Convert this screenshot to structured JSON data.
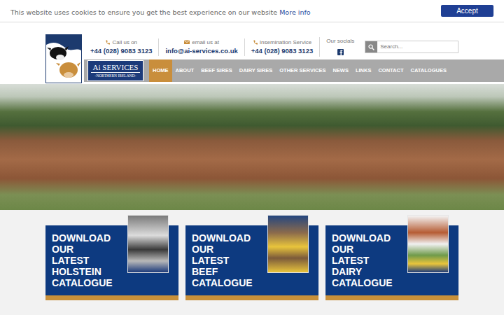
{
  "cookie_bar": {
    "text": "This website uses cookies to ensure you get the best experience on our website",
    "link": "More info",
    "button": "Accept"
  },
  "logo": {
    "title": "Ai SERVICES",
    "subtitle": "-NORTHERN IRELAND-"
  },
  "contacts": [
    {
      "label": "Call us on",
      "value": "+44 (028) 9083 3123",
      "kind": "phone"
    },
    {
      "label": "email us at",
      "value": "info@ai-services.co.uk",
      "kind": "email"
    },
    {
      "label": "Insemination Service",
      "value": "+44 (028) 9083 3123",
      "kind": "phone"
    },
    {
      "label": "Our socials",
      "kind": "social"
    }
  ],
  "search": {
    "placeholder": "Search..."
  },
  "nav": [
    {
      "label": "HOME",
      "selected": true
    },
    {
      "label": "ABOUT",
      "selected": false
    },
    {
      "label": "BEEF SIRES",
      "selected": false
    },
    {
      "label": "DAIRY SIRES",
      "selected": false
    },
    {
      "label": "OTHER SERVICES",
      "selected": false
    },
    {
      "label": "NEWS",
      "selected": false
    },
    {
      "label": "LINKS",
      "selected": false
    },
    {
      "label": "CONTACT",
      "selected": false
    },
    {
      "label": "CATALOGUES",
      "selected": false
    }
  ],
  "catalogues": [
    {
      "title": "DOWNLOAD OUR LATEST HOLSTEIN CATALOGUE",
      "kind": "holstein"
    },
    {
      "title": "DOWNLOAD OUR LATEST BEEF CATALOGUE",
      "kind": "beef"
    },
    {
      "title": "DOWNLOAD OUR LATEST DAIRY CATALOGUE",
      "kind": "dairy"
    }
  ]
}
